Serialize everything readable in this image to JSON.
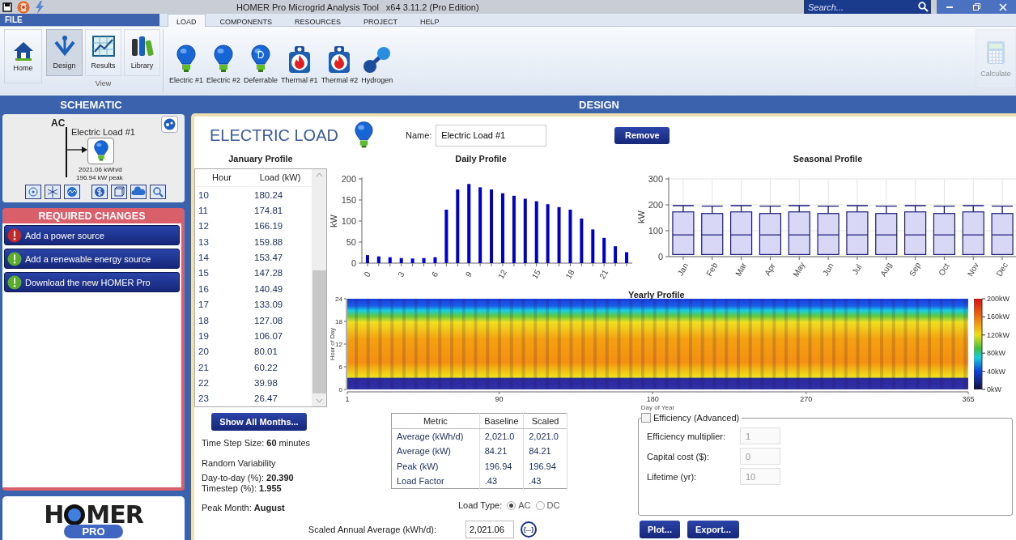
{
  "title_bar": {
    "title": "HOMER Pro Microgrid Analysis Tool",
    "version": "x64 3.11.2 (Pro Edition)",
    "search": {
      "placeholder": "Search..."
    }
  },
  "file_menu": "FILE",
  "tabs": [
    {
      "label": "LOAD",
      "selected": true
    },
    {
      "label": "COMPONENTS",
      "selected": false
    },
    {
      "label": "RESOURCES",
      "selected": false
    },
    {
      "label": "PROJECT",
      "selected": false
    },
    {
      "label": "HELP",
      "selected": false
    }
  ],
  "ribbon": {
    "home": "Home",
    "view_group": {
      "label": "View",
      "buttons": [
        {
          "label": "Design",
          "selected": true,
          "kind": "design"
        },
        {
          "label": "Results",
          "selected": false,
          "kind": "results"
        },
        {
          "label": "Library",
          "selected": false,
          "kind": "library"
        }
      ]
    },
    "loads": [
      {
        "label": "Electric #1",
        "kind": "bulb"
      },
      {
        "label": "Electric #2",
        "kind": "bulb"
      },
      {
        "label": "Deferrable",
        "kind": "deferrable",
        "icon_letter": "D"
      },
      {
        "label": "Thermal #1",
        "kind": "thermal"
      },
      {
        "label": "Thermal #2",
        "kind": "thermal"
      },
      {
        "label": "Hydrogen",
        "kind": "hydrogen"
      }
    ],
    "calculate": {
      "label": "Calculate",
      "disabled": true
    }
  },
  "section_headers": {
    "left": "SCHEMATIC",
    "right": "DESIGN"
  },
  "schematic": {
    "bus": "AC",
    "load_name": "Electric Load #1",
    "daily_energy": "2021.06 kWh/d",
    "peak": "196.94 kW peak"
  },
  "required_changes": {
    "title": "REQUIRED CHANGES",
    "items": [
      {
        "label": "Add a power source",
        "color": "#c62828"
      },
      {
        "label": "Add a renewable energy source",
        "color": "#5aad2a"
      },
      {
        "label": "Download the new HOMER Pro",
        "color": "#5aad2a"
      }
    ]
  },
  "logo": {
    "left": "H",
    "right": "MER",
    "badge": "PRO"
  },
  "design": {
    "heading": "ELECTRIC LOAD",
    "name_label": "Name:",
    "name_value": "Electric Load #1",
    "remove_button": "Remove",
    "january_profile": {
      "title": "January Profile",
      "columns": [
        "Hour",
        "Load (kW)"
      ],
      "rows": [
        [
          "10",
          "180.24"
        ],
        [
          "11",
          "174.81"
        ],
        [
          "12",
          "166.19"
        ],
        [
          "13",
          "159.88"
        ],
        [
          "14",
          "153.47"
        ],
        [
          "15",
          "147.28"
        ],
        [
          "16",
          "140.49"
        ],
        [
          "17",
          "133.09"
        ],
        [
          "18",
          "127.08"
        ],
        [
          "19",
          "106.07"
        ],
        [
          "20",
          "80.01"
        ],
        [
          "21",
          "60.22"
        ],
        [
          "22",
          "39.98"
        ],
        [
          "23",
          "26.47"
        ]
      ]
    },
    "daily_profile": {
      "chart_data": {
        "type": "bar",
        "title": "Daily Profile",
        "ylabel": "kW",
        "x": [
          0,
          1,
          2,
          3,
          4,
          5,
          6,
          7,
          8,
          9,
          10,
          11,
          12,
          13,
          14,
          15,
          16,
          17,
          18,
          19,
          20,
          21,
          22,
          23
        ],
        "series": [
          {
            "color": "#0000cc",
            "values": [
              19,
              16,
              14,
              12,
              11,
              12,
              14,
              127,
              175,
              188,
              180,
              175,
              166,
              160,
              153,
              147,
              140,
              133,
              127,
              106,
              80,
              60,
              40,
              26
            ]
          }
        ],
        "xlim": [
          -0.5,
          23.5
        ],
        "ylim": [
          0,
          200
        ],
        "yticks": [
          0,
          50,
          100,
          150,
          200
        ],
        "xticks": [
          0,
          3,
          6,
          9,
          12,
          15,
          18,
          21
        ]
      }
    },
    "seasonal_profile": {
      "title": "Seasonal Profile",
      "ylabel": "kW",
      "yticks": [
        "300",
        "200",
        "100",
        "0"
      ],
      "months": [
        "Jan",
        "Feb",
        "Mar",
        "Apr",
        "May",
        "Jun",
        "Jul",
        "Aug",
        "Sep",
        "Oct",
        "Nov",
        "Dec"
      ]
    },
    "yearly_profile": {
      "title": "Yearly Profile",
      "ylabel": "Hour of Day",
      "xlabel": "Day of Year",
      "yticks": [
        "24",
        "18",
        "12",
        "6",
        "0"
      ],
      "xticks": [
        "1",
        "90",
        "180",
        "270",
        "365"
      ],
      "color_scale": [
        "200kW",
        "160kW",
        "120kW",
        "80kW",
        "40kW",
        "0kW"
      ]
    },
    "show_all_button": "Show All Months...",
    "time_step": "Time Step Size: **60** minutes",
    "random_variability": {
      "title": "Random Variability",
      "day_to_day": "Day-to-day (%): **20.390**",
      "timestep": "Timestep (%): **1.955**"
    },
    "peak_month": "Peak Month: **August**",
    "metrics": {
      "columns": [
        "Metric",
        "Baseline",
        "Scaled"
      ],
      "rows": [
        [
          "Average (kWh/d)",
          "2,021.0",
          "2,021.0"
        ],
        [
          "Average (kW)",
          "84.21",
          "84.21"
        ],
        [
          "Peak (kW)",
          "196.94",
          "196.94"
        ],
        [
          "Load Factor",
          ".43",
          ".43"
        ]
      ]
    },
    "load_type": {
      "label": "Load Type:",
      "options": [
        {
          "label": "AC",
          "selected": true
        },
        {
          "label": "DC",
          "selected": false
        }
      ]
    },
    "scaled_average": {
      "label": "Scaled Annual Average (kWh/d):",
      "value": "2,021.06",
      "button": "{...}"
    },
    "efficiency": {
      "label": "Efficiency (Advanced)",
      "checked": false,
      "fields": [
        {
          "label": "Efficiency multiplier:",
          "value": "1",
          "disabled": true
        },
        {
          "label": "Capital cost ($):",
          "value": "0",
          "disabled": true
        },
        {
          "label": "Lifetime (yr):",
          "value": "10",
          "disabled": true
        }
      ]
    },
    "buttons": [
      "Plot...",
      "Export..."
    ]
  }
}
